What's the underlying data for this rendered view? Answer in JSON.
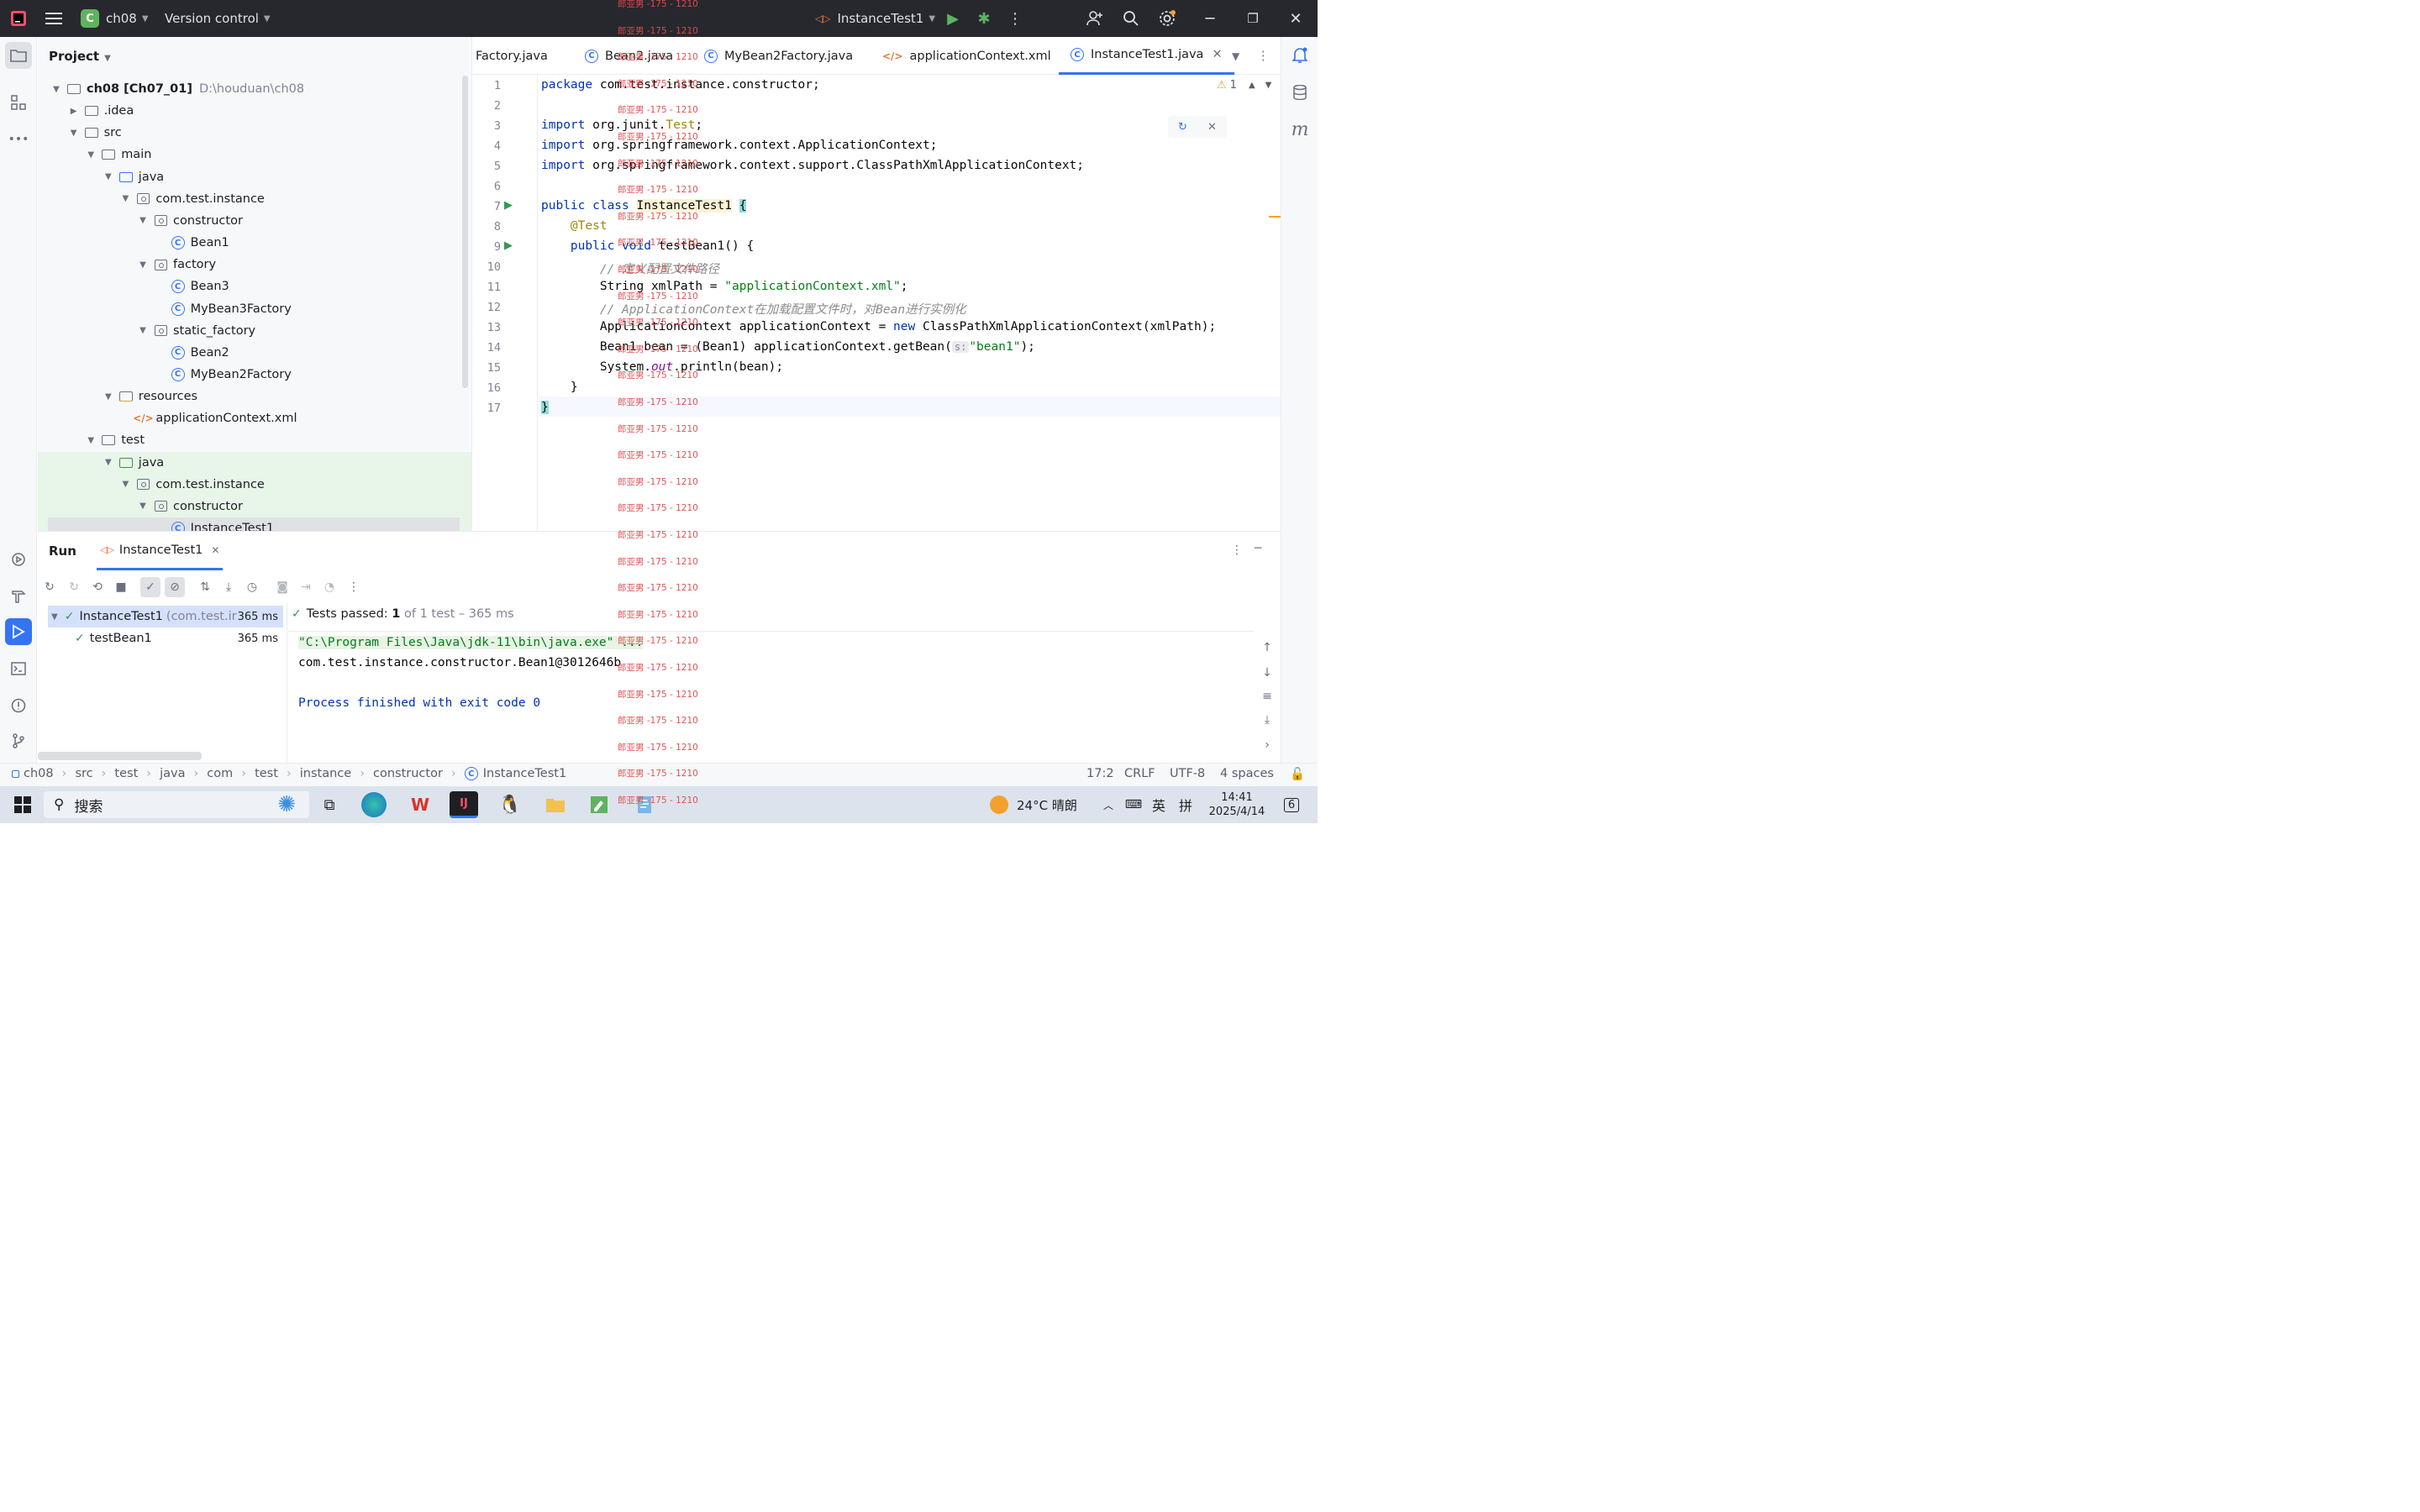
{
  "titlebar": {
    "project_badge": "C",
    "project_name": "ch08",
    "vcs": "Version control",
    "run_config": "InstanceTest1"
  },
  "project_panel": {
    "title": "Project",
    "items": [
      {
        "label": "ch08 [Ch07_01]",
        "extra": "D:\\houduan\\ch08",
        "type": "module",
        "depth": 0,
        "open": true
      },
      {
        "label": ".idea",
        "type": "folder",
        "depth": 1,
        "open": false
      },
      {
        "label": "src",
        "type": "folder",
        "depth": 1,
        "open": true
      },
      {
        "label": "main",
        "type": "folder",
        "depth": 2,
        "open": true
      },
      {
        "label": "java",
        "type": "folder-blue",
        "depth": 3,
        "open": true
      },
      {
        "label": "com.test.instance",
        "type": "package",
        "depth": 4,
        "open": true
      },
      {
        "label": "constructor",
        "type": "package",
        "depth": 5,
        "open": true
      },
      {
        "label": "Bean1",
        "type": "class",
        "depth": 6
      },
      {
        "label": "factory",
        "type": "package",
        "depth": 5,
        "open": true
      },
      {
        "label": "Bean3",
        "type": "class",
        "depth": 6
      },
      {
        "label": "MyBean3Factory",
        "type": "class",
        "depth": 6
      },
      {
        "label": "static_factory",
        "type": "package",
        "depth": 5,
        "open": true
      },
      {
        "label": "Bean2",
        "type": "class",
        "depth": 6
      },
      {
        "label": "MyBean2Factory",
        "type": "class",
        "depth": 6
      },
      {
        "label": "resources",
        "type": "folder-res",
        "depth": 3,
        "open": true
      },
      {
        "label": "applicationContext.xml",
        "type": "xml",
        "depth": 4
      },
      {
        "label": "test",
        "type": "folder",
        "depth": 2,
        "open": true
      },
      {
        "label": "java",
        "type": "folder-green",
        "depth": 3,
        "open": true
      },
      {
        "label": "com.test.instance",
        "type": "package",
        "depth": 4,
        "open": true
      },
      {
        "label": "constructor",
        "type": "package",
        "depth": 5,
        "open": true
      },
      {
        "label": "InstanceTest1",
        "type": "class",
        "depth": 6
      }
    ]
  },
  "editor": {
    "tabs": [
      {
        "label": "Factory.java",
        "icon": "class-icon"
      },
      {
        "label": "Bean2.java",
        "icon": "class-icon"
      },
      {
        "label": "MyBean2Factory.java",
        "icon": "class-icon"
      },
      {
        "label": "applicationContext.xml",
        "icon": "xml-icon"
      },
      {
        "label": "InstanceTest1.java",
        "icon": "class-icon",
        "active": true
      }
    ],
    "warnings": "1",
    "line_numbers": [
      "1",
      "2",
      "3",
      "4",
      "5",
      "6",
      "7",
      "8",
      "9",
      "10",
      "11",
      "12",
      "13",
      "14",
      "15",
      "16",
      "17"
    ],
    "code": {
      "l1_kw": "package",
      "l1_rest": " com.test.instance.constructor;",
      "l3_kw": "import",
      "l3_a": " org.junit.",
      "l3_ann": "Test",
      "l3_b": ";",
      "l4_kw": "import",
      "l4_rest": " org.springframework.context.ApplicationContext;",
      "l5_kw": "import",
      "l5_rest": " org.springframework.context.support.ClassPathXmlApplicationContext;",
      "l7_kw": "public class",
      "l7_name": "InstanceTest1",
      "l7_brace": "{",
      "l8_ann": "@Test",
      "l9_kw": "public void",
      "l9_rest": " testBean1() {",
      "l10_cmt": "// 定义配置文件路径",
      "l11_a": "String xmlPath = ",
      "l11_str": "\"applicationContext.xml\"",
      "l11_b": ";",
      "l12_cmt": "// ApplicationContext在加载配置文件时，对Bean进行实例化",
      "l13_a": "ApplicationContext applicationContext = ",
      "l13_kw": "new",
      "l13_b": " ClassPathXmlApplicationContext(xmlPath);",
      "l14_a": "Bean1 bean = (Bean1) applicationContext.getBean(",
      "l14_hint": "s:",
      "l14_str": "\"bean1\"",
      "l14_b": ");",
      "l15_a": "System.",
      "l15_fld": "out",
      "l15_b": ".println(bean);",
      "l16": "}",
      "l17": "}"
    }
  },
  "watermark": "郎亚男 -175 - 1210",
  "run_panel": {
    "title": "Run",
    "tab": "InstanceTest1",
    "tests": [
      {
        "name": "InstanceTest1",
        "pkg": "(com.test.ir",
        "time": "365 ms"
      },
      {
        "name": "testBean1",
        "time": "365 ms"
      }
    ],
    "summary_label": "Tests passed:",
    "summary_count": "1",
    "summary_rest": "of 1 test – 365 ms",
    "console": [
      "\"C:\\Program Files\\Java\\jdk-11\\bin\\java.exe\" ...",
      "com.test.instance.constructor.Bean1@3012646b",
      "",
      "Process finished with exit code 0"
    ]
  },
  "statusbar": {
    "breadcrumbs": [
      "ch08",
      "src",
      "test",
      "java",
      "com",
      "test",
      "instance",
      "constructor",
      "InstanceTest1"
    ],
    "position": "17:2",
    "line_sep": "CRLF",
    "encoding": "UTF-8",
    "indent": "4 spaces"
  },
  "taskbar": {
    "search": "搜索",
    "weather": "24°C 晴朗",
    "lang": "英",
    "time": "14:41",
    "date": "2025/4/14",
    "notif": "6"
  }
}
